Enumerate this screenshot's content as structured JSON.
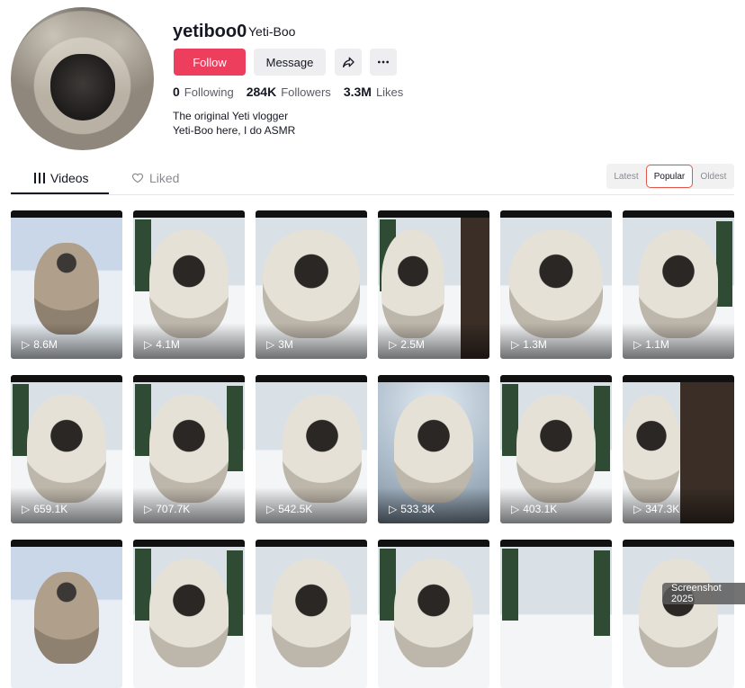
{
  "profile": {
    "username": "yetiboo0",
    "display_name": "Yeti-Boo",
    "follow_label": "Follow",
    "message_label": "Message",
    "stats": [
      {
        "num": "0",
        "label": "Following"
      },
      {
        "num": "284K",
        "label": "Followers"
      },
      {
        "num": "3.3M",
        "label": "Likes"
      }
    ],
    "bio": [
      "The original Yeti vlogger",
      "Yeti-Boo here, I do ASMR"
    ]
  },
  "tabs": {
    "videos": "Videos",
    "liked": "Liked"
  },
  "sort": {
    "latest": "Latest",
    "popular": "Popular",
    "oldest": "Oldest"
  },
  "videos": [
    {
      "views": "8.6M"
    },
    {
      "views": "4.1M"
    },
    {
      "views": "3M"
    },
    {
      "views": "2.5M"
    },
    {
      "views": "1.3M"
    },
    {
      "views": "1.1M"
    },
    {
      "views": "659.1K"
    },
    {
      "views": "707.7K"
    },
    {
      "views": "542.5K"
    },
    {
      "views": "533.3K"
    },
    {
      "views": "403.1K"
    },
    {
      "views": "347.3K"
    },
    {
      "views": ""
    },
    {
      "views": ""
    },
    {
      "views": ""
    },
    {
      "views": ""
    },
    {
      "views": ""
    },
    {
      "views": ""
    }
  ],
  "overlay": {
    "screenshot_label": "Screenshot 2025"
  },
  "colors": {
    "follow": "#ee3e5e",
    "sort_highlight": "#e2574c"
  }
}
